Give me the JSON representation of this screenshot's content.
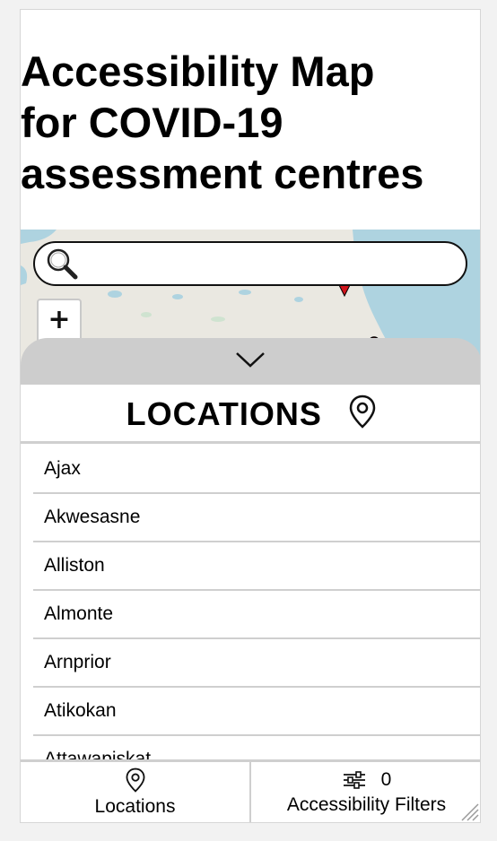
{
  "page": {
    "title": "Accessibility Map\nfor COVID-19\nassessment centres"
  },
  "search": {
    "value": "",
    "placeholder": ""
  },
  "map": {
    "zoom_in_label": "+",
    "marker_color": "#d0141c",
    "water_color": "#aed3e0",
    "land_color": "#eae8e1"
  },
  "locations_panel": {
    "title": "LOCATIONS",
    "items": [
      "Ajax",
      "Akwesasne",
      "Alliston",
      "Almonte",
      "Arnprior",
      "Atikokan",
      "Attawapiskat"
    ]
  },
  "tabbar": {
    "locations_label": "Locations",
    "filters_label": "Accessibility Filters",
    "filters_count": "0"
  },
  "icons": {
    "search": "search-icon",
    "pin": "map-pin-icon",
    "chevron": "chevron-down-icon",
    "filters": "sliders-icon"
  }
}
